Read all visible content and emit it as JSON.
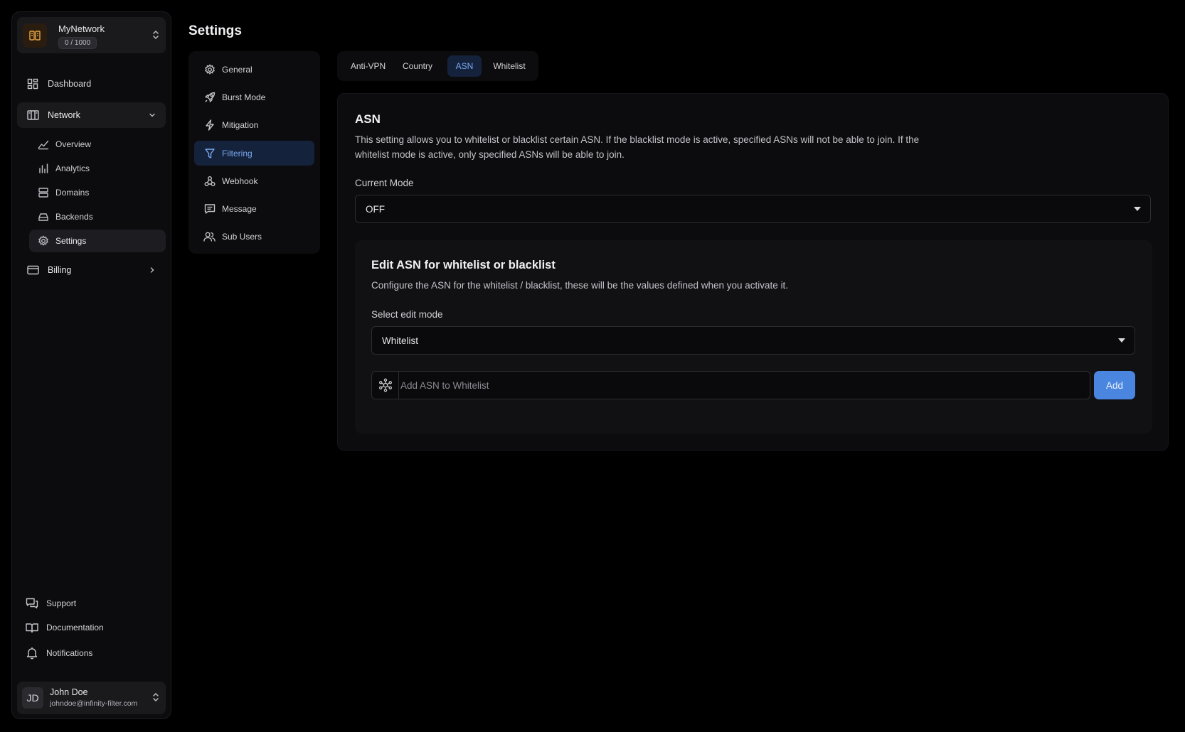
{
  "network": {
    "name": "MyNetwork",
    "quota": "0 / 1000"
  },
  "sidebar": {
    "dashboard": "Dashboard",
    "network": "Network",
    "sub_items": [
      "Overview",
      "Analytics",
      "Domains",
      "Backends",
      "Settings"
    ],
    "billing": "Billing"
  },
  "footer": {
    "support": "Support",
    "documentation": "Documentation",
    "notifications": "Notifications"
  },
  "user": {
    "initials": "JD",
    "name": "John Doe",
    "email": "johndoe@infinity-filter.com"
  },
  "page": {
    "title": "Settings"
  },
  "settings_nav": [
    "General",
    "Burst Mode",
    "Mitigation",
    "Filtering",
    "Webhook",
    "Message",
    "Sub Users"
  ],
  "settings_nav_active": "Filtering",
  "tabs": [
    "Anti-VPN",
    "Country",
    "ASN",
    "Whitelist"
  ],
  "tabs_active": "ASN",
  "asn": {
    "title": "ASN",
    "description": "This setting allows you to whitelist or blacklist certain ASN. If the blacklist mode is active, specified ASNs will not be able to join. If the whitelist mode is active, only specified ASNs will be able to join.",
    "current_mode_label": "Current Mode",
    "current_mode_value": "OFF"
  },
  "edit": {
    "title": "Edit ASN for whitelist or blacklist",
    "description": "Configure the ASN for the whitelist / blacklist, these will be the values defined when you activate it.",
    "mode_label": "Select edit mode",
    "mode_value": "Whitelist",
    "input_placeholder": "Add ASN to Whitelist",
    "input_value": "",
    "add_label": "Add"
  },
  "colors": {
    "accent": "#4a86e0",
    "active_bg": "#15223b",
    "active_text": "#7aa9f0",
    "logo_accent": "#e8a640"
  },
  "icons": {
    "network_logo": "server-rack-icon",
    "dashboard": "grid-icon",
    "network": "network-panel-icon",
    "overview": "trend-line-icon",
    "analytics": "bar-chart-icon",
    "domains": "server-stack-icon",
    "backends": "hard-drive-icon",
    "settings": "gear-icon",
    "billing": "credit-card-icon",
    "support": "chat-bubbles-icon",
    "documentation": "book-open-icon",
    "notifications": "bell-icon",
    "asn_input": "hub-network-icon"
  }
}
